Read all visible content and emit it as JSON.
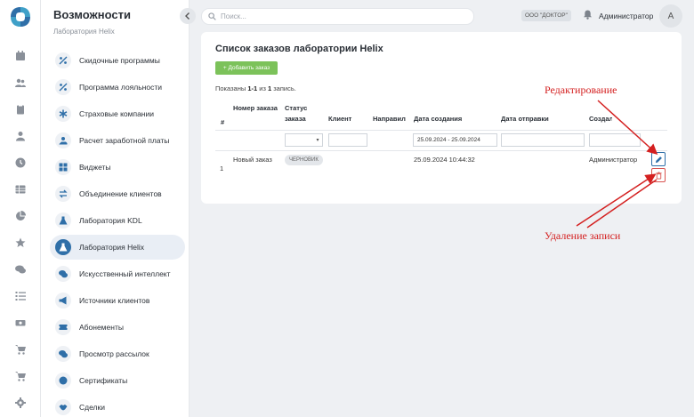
{
  "rail": {
    "icons": [
      "logo-icon",
      "calendar-icon",
      "users-icon",
      "clipboard-icon",
      "user-icon",
      "clock-icon",
      "table-icon",
      "pie-chart-icon",
      "star-icon",
      "chat-icon",
      "list-check-icon",
      "cash-icon",
      "cart-icon",
      "cart-add-icon",
      "gear-icon"
    ]
  },
  "sidebar": {
    "title": "Возможности",
    "subtitle": "Лаборатория Helix",
    "items": [
      {
        "label": "Скидочные программы",
        "icon": "percent-icon"
      },
      {
        "label": "Программа лояльности",
        "icon": "percent-icon"
      },
      {
        "label": "Страховые компании",
        "icon": "asterisk-icon"
      },
      {
        "label": "Расчет заработной платы",
        "icon": "hand-coin-icon"
      },
      {
        "label": "Виджеты",
        "icon": "grid-icon"
      },
      {
        "label": "Объединение клиентов",
        "icon": "merge-arrows-icon"
      },
      {
        "label": "Лаборатория KDL",
        "icon": "flask-icon"
      },
      {
        "label": "Лаборатория Helix",
        "icon": "flask-icon"
      },
      {
        "label": "Искусственный интеллект",
        "icon": "chat-bubbles-icon"
      },
      {
        "label": "Источники клиентов",
        "icon": "megaphone-icon"
      },
      {
        "label": "Абонементы",
        "icon": "ticket-icon"
      },
      {
        "label": "Просмотр рассылок",
        "icon": "chat-bubbles-icon"
      },
      {
        "label": "Сертификаты",
        "icon": "certificate-icon"
      },
      {
        "label": "Сделки",
        "icon": "handshake-icon"
      }
    ],
    "active_index": 7
  },
  "topbar": {
    "search_placeholder": "Поиск...",
    "org_badge": "ООО \"ДОКТОР\"",
    "user_name": "Администратор",
    "avatar_letter": "A"
  },
  "main": {
    "title": "Список заказов лаборатории Helix",
    "add_button": "+ Добавить заказ",
    "shown_prefix": "Показаны ",
    "shown_range": "1-1",
    "shown_middle": " из ",
    "shown_total": "1",
    "shown_suffix": " запись.",
    "columns": [
      "#",
      "Номер заказа",
      "Статус заказа",
      "Клиент",
      "Направил",
      "Дата создания",
      "Дата отправки",
      "Создал"
    ],
    "filters": {
      "date_created": "25.09.2024 - 25.09.2024"
    },
    "rows": [
      {
        "num": "1",
        "order_number": "Новый заказ",
        "status": "ЧЕРНОВИК",
        "client": "",
        "referrer": "",
        "created_at": "25.09.2024 10:44:32",
        "sent_at": "",
        "created_by": "Администратор"
      }
    ]
  },
  "annotations": {
    "edit": "Редактирование",
    "delete": "Удаление записи"
  },
  "colors": {
    "accent": "#2f6fa8",
    "add_button": "#7cc25a",
    "annotation": "#d42020",
    "delete": "#d9534f"
  }
}
